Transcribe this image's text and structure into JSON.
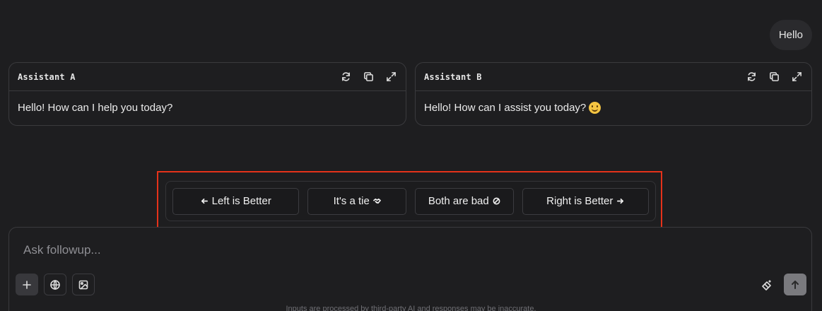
{
  "user_message": "Hello",
  "panel_a": {
    "title": "Assistant A",
    "response": "Hello! How can I help you today?"
  },
  "panel_b": {
    "title": "Assistant B",
    "response": "Hello! How can I assist you today?",
    "trailing_emoji": "smiling-face"
  },
  "panel_tools": [
    "refresh-icon",
    "copy-icon",
    "expand-icon"
  ],
  "vote": {
    "left": "Left is Better",
    "tie": "It's a tie",
    "bad": "Both are bad",
    "right": "Right is Better"
  },
  "composer": {
    "placeholder": "Ask followup...",
    "buttons": [
      "plus-icon",
      "globe-icon",
      "image-icon",
      "magic-icon",
      "send-icon"
    ]
  },
  "disclaimer": "Inputs are processed by third-party AI and responses may be inaccurate.",
  "colors": {
    "background": "#1e1e20",
    "highlight": "#e5321a",
    "send_button": "#7a7a7e"
  }
}
